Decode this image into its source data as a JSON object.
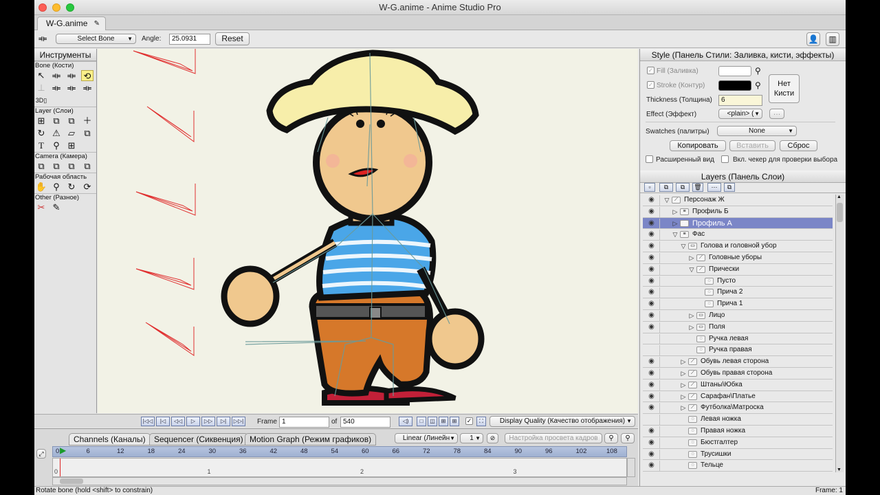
{
  "window": {
    "title": "W-G.anime - Anime Studio Pro",
    "doc_tab": "W-G.anime"
  },
  "colors": {
    "accent_selected": "#7b86c7",
    "bone_red": "#e03030",
    "canvas_bg": "#f2f2e6"
  },
  "toolbar": {
    "bone_select": "Select Bone",
    "angle_label": "Angle:",
    "angle_value": "25.0931",
    "reset_label": "Reset"
  },
  "tools_panel": {
    "title": "Инструменты",
    "groups": {
      "bone": "Bone (Кости)",
      "layer": "Layer (Слои)",
      "camera": "Camera (Камера)",
      "workspace": "Рабочая область",
      "other": "Other (Разное)"
    },
    "label_3d": "3D"
  },
  "frame_controls": {
    "frame_label": "Frame",
    "frame_value": "1",
    "of_label": "of",
    "total_frames": "540",
    "display_quality": "Display Quality (Качество отображения)"
  },
  "timeline": {
    "tabs": [
      "Channels (Каналы)",
      "Sequencer (Сиквенция)",
      "Motion Graph (Режим графиков)"
    ],
    "interp": "Linear (Линейн",
    "interp_step": "1",
    "onion": "Настройка просвета кадров",
    "ruler": [
      "0",
      "6",
      "12",
      "18",
      "24",
      "30",
      "36",
      "42",
      "48",
      "54",
      "60",
      "66",
      "72",
      "78",
      "84",
      "90",
      "96",
      "102",
      "108"
    ],
    "seconds": [
      "0",
      "1",
      "2",
      "3"
    ]
  },
  "status": {
    "text": "Rotate bone (hold <shift> to constrain)",
    "frame": "Frame: 1"
  },
  "style_panel": {
    "title": "Style (Панель Стили: Заливка, кисти, эффекты)",
    "fill_label": "Fill (Заливка)",
    "stroke_label": "Stroke (Контур)",
    "thickness_label": "Thickness (Толщина)",
    "thickness_value": "6",
    "effect_label": "Effect (Эффект)",
    "effect_value": "<plain> (",
    "no_brush": "Нет Кисти",
    "swatches_label": "Swatches (палитры)",
    "swatches_value": "None",
    "copy": "Копировать",
    "paste": "Вставить",
    "reset": "Сброс",
    "advanced": "Расширенный вид",
    "checker": "Вкл. чекер для проверки выбора"
  },
  "layers_panel": {
    "title": "Layers (Панель Слои)",
    "items": [
      {
        "name": "Персонаж Ж",
        "indent": 0,
        "arrow": "▽",
        "icon": "bone",
        "eye": true
      },
      {
        "name": "Профиль Б",
        "indent": 1,
        "arrow": "▷",
        "icon": "switch",
        "eye": true
      },
      {
        "name": "Профиль А",
        "indent": 1,
        "arrow": "▷",
        "icon": "bone",
        "eye": true,
        "selected": true
      },
      {
        "name": "Фас",
        "indent": 1,
        "arrow": "▽",
        "icon": "switch",
        "eye": true
      },
      {
        "name": "Голова и головной убор",
        "indent": 2,
        "arrow": "▽",
        "icon": "group",
        "eye": true
      },
      {
        "name": "Головные уборы",
        "indent": 3,
        "arrow": "▷",
        "icon": "bone",
        "eye": true
      },
      {
        "name": "Прически",
        "indent": 3,
        "arrow": "▽",
        "icon": "bone",
        "eye": true
      },
      {
        "name": "Пусто",
        "indent": 4,
        "arrow": "",
        "icon": "vector",
        "eye": true
      },
      {
        "name": "Прича 2",
        "indent": 4,
        "arrow": "",
        "icon": "vector",
        "eye": true
      },
      {
        "name": "Прича 1",
        "indent": 4,
        "arrow": "",
        "icon": "vector",
        "eye": true
      },
      {
        "name": "Лицо",
        "indent": 3,
        "arrow": "▷",
        "icon": "group",
        "eye": true
      },
      {
        "name": "Поля",
        "indent": 3,
        "arrow": "▷",
        "icon": "group",
        "eye": true
      },
      {
        "name": "Ручка левая",
        "indent": 3,
        "arrow": "",
        "icon": "vector",
        "eye": false
      },
      {
        "name": "Ручка правая",
        "indent": 3,
        "arrow": "",
        "icon": "vector",
        "eye": false
      },
      {
        "name": "Обувь левая сторона",
        "indent": 2,
        "arrow": "▷",
        "icon": "bone",
        "eye": true
      },
      {
        "name": "Обувь правая сторона",
        "indent": 2,
        "arrow": "▷",
        "icon": "bone",
        "eye": true
      },
      {
        "name": "Штаны\\Юбка",
        "indent": 2,
        "arrow": "▷",
        "icon": "bone",
        "eye": true
      },
      {
        "name": "Сарафан\\Платье",
        "indent": 2,
        "arrow": "▷",
        "icon": "bone",
        "eye": true
      },
      {
        "name": "Футболка\\Матроска",
        "indent": 2,
        "arrow": "▷",
        "icon": "bone",
        "eye": true
      },
      {
        "name": "Левая ножка",
        "indent": 2,
        "arrow": "",
        "icon": "vector",
        "eye": false
      },
      {
        "name": "Правая ножка",
        "indent": 2,
        "arrow": "",
        "icon": "vector",
        "eye": true
      },
      {
        "name": "Бюстгалтер",
        "indent": 2,
        "arrow": "",
        "icon": "vector",
        "eye": true
      },
      {
        "name": "Трусишки",
        "indent": 2,
        "arrow": "",
        "icon": "vector",
        "eye": true
      },
      {
        "name": "Тельце",
        "indent": 2,
        "arrow": "",
        "icon": "vector",
        "eye": true
      }
    ]
  }
}
